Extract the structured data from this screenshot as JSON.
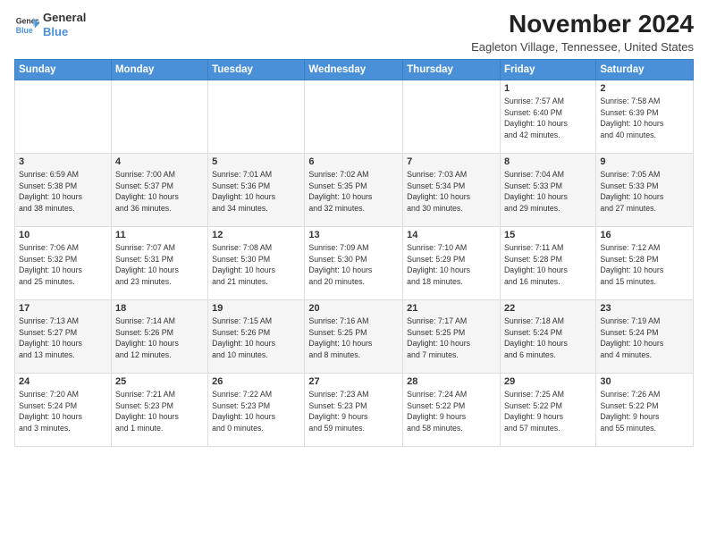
{
  "header": {
    "logo_line1": "General",
    "logo_line2": "Blue",
    "month": "November 2024",
    "location": "Eagleton Village, Tennessee, United States"
  },
  "weekdays": [
    "Sunday",
    "Monday",
    "Tuesday",
    "Wednesday",
    "Thursday",
    "Friday",
    "Saturday"
  ],
  "weeks": [
    [
      {
        "day": "",
        "info": ""
      },
      {
        "day": "",
        "info": ""
      },
      {
        "day": "",
        "info": ""
      },
      {
        "day": "",
        "info": ""
      },
      {
        "day": "",
        "info": ""
      },
      {
        "day": "1",
        "info": "Sunrise: 7:57 AM\nSunset: 6:40 PM\nDaylight: 10 hours\nand 42 minutes."
      },
      {
        "day": "2",
        "info": "Sunrise: 7:58 AM\nSunset: 6:39 PM\nDaylight: 10 hours\nand 40 minutes."
      }
    ],
    [
      {
        "day": "3",
        "info": "Sunrise: 6:59 AM\nSunset: 5:38 PM\nDaylight: 10 hours\nand 38 minutes."
      },
      {
        "day": "4",
        "info": "Sunrise: 7:00 AM\nSunset: 5:37 PM\nDaylight: 10 hours\nand 36 minutes."
      },
      {
        "day": "5",
        "info": "Sunrise: 7:01 AM\nSunset: 5:36 PM\nDaylight: 10 hours\nand 34 minutes."
      },
      {
        "day": "6",
        "info": "Sunrise: 7:02 AM\nSunset: 5:35 PM\nDaylight: 10 hours\nand 32 minutes."
      },
      {
        "day": "7",
        "info": "Sunrise: 7:03 AM\nSunset: 5:34 PM\nDaylight: 10 hours\nand 30 minutes."
      },
      {
        "day": "8",
        "info": "Sunrise: 7:04 AM\nSunset: 5:33 PM\nDaylight: 10 hours\nand 29 minutes."
      },
      {
        "day": "9",
        "info": "Sunrise: 7:05 AM\nSunset: 5:33 PM\nDaylight: 10 hours\nand 27 minutes."
      }
    ],
    [
      {
        "day": "10",
        "info": "Sunrise: 7:06 AM\nSunset: 5:32 PM\nDaylight: 10 hours\nand 25 minutes."
      },
      {
        "day": "11",
        "info": "Sunrise: 7:07 AM\nSunset: 5:31 PM\nDaylight: 10 hours\nand 23 minutes."
      },
      {
        "day": "12",
        "info": "Sunrise: 7:08 AM\nSunset: 5:30 PM\nDaylight: 10 hours\nand 21 minutes."
      },
      {
        "day": "13",
        "info": "Sunrise: 7:09 AM\nSunset: 5:30 PM\nDaylight: 10 hours\nand 20 minutes."
      },
      {
        "day": "14",
        "info": "Sunrise: 7:10 AM\nSunset: 5:29 PM\nDaylight: 10 hours\nand 18 minutes."
      },
      {
        "day": "15",
        "info": "Sunrise: 7:11 AM\nSunset: 5:28 PM\nDaylight: 10 hours\nand 16 minutes."
      },
      {
        "day": "16",
        "info": "Sunrise: 7:12 AM\nSunset: 5:28 PM\nDaylight: 10 hours\nand 15 minutes."
      }
    ],
    [
      {
        "day": "17",
        "info": "Sunrise: 7:13 AM\nSunset: 5:27 PM\nDaylight: 10 hours\nand 13 minutes."
      },
      {
        "day": "18",
        "info": "Sunrise: 7:14 AM\nSunset: 5:26 PM\nDaylight: 10 hours\nand 12 minutes."
      },
      {
        "day": "19",
        "info": "Sunrise: 7:15 AM\nSunset: 5:26 PM\nDaylight: 10 hours\nand 10 minutes."
      },
      {
        "day": "20",
        "info": "Sunrise: 7:16 AM\nSunset: 5:25 PM\nDaylight: 10 hours\nand 8 minutes."
      },
      {
        "day": "21",
        "info": "Sunrise: 7:17 AM\nSunset: 5:25 PM\nDaylight: 10 hours\nand 7 minutes."
      },
      {
        "day": "22",
        "info": "Sunrise: 7:18 AM\nSunset: 5:24 PM\nDaylight: 10 hours\nand 6 minutes."
      },
      {
        "day": "23",
        "info": "Sunrise: 7:19 AM\nSunset: 5:24 PM\nDaylight: 10 hours\nand 4 minutes."
      }
    ],
    [
      {
        "day": "24",
        "info": "Sunrise: 7:20 AM\nSunset: 5:24 PM\nDaylight: 10 hours\nand 3 minutes."
      },
      {
        "day": "25",
        "info": "Sunrise: 7:21 AM\nSunset: 5:23 PM\nDaylight: 10 hours\nand 1 minute."
      },
      {
        "day": "26",
        "info": "Sunrise: 7:22 AM\nSunset: 5:23 PM\nDaylight: 10 hours\nand 0 minutes."
      },
      {
        "day": "27",
        "info": "Sunrise: 7:23 AM\nSunset: 5:23 PM\nDaylight: 9 hours\nand 59 minutes."
      },
      {
        "day": "28",
        "info": "Sunrise: 7:24 AM\nSunset: 5:22 PM\nDaylight: 9 hours\nand 58 minutes."
      },
      {
        "day": "29",
        "info": "Sunrise: 7:25 AM\nSunset: 5:22 PM\nDaylight: 9 hours\nand 57 minutes."
      },
      {
        "day": "30",
        "info": "Sunrise: 7:26 AM\nSunset: 5:22 PM\nDaylight: 9 hours\nand 55 minutes."
      }
    ]
  ]
}
